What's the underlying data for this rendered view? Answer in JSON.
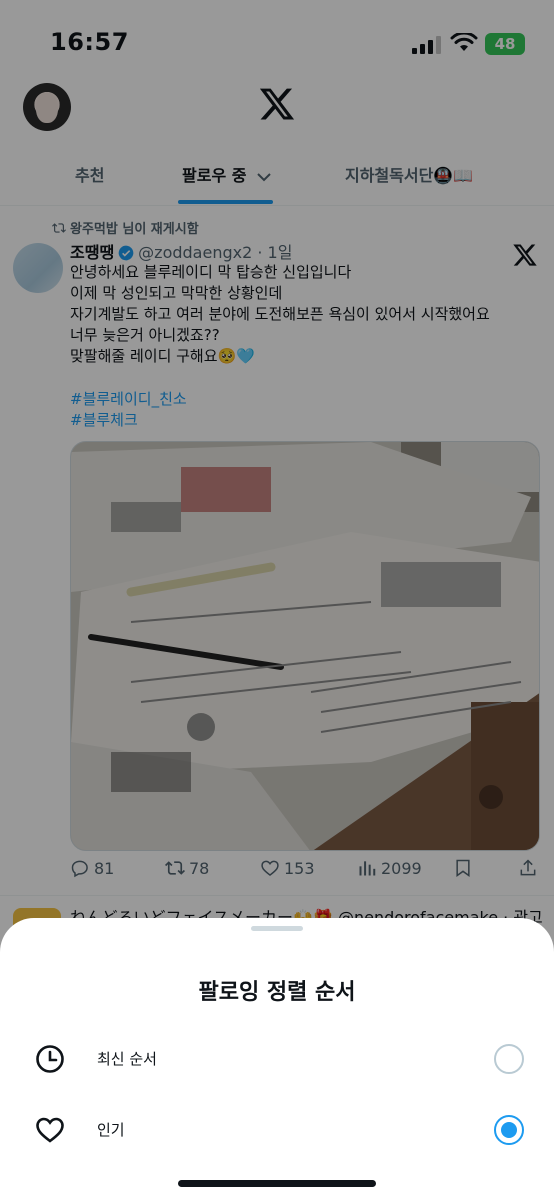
{
  "status_bar": {
    "time": "16:57",
    "battery": "48"
  },
  "tabs": [
    {
      "label": "추천"
    },
    {
      "label": "팔로우 중"
    },
    {
      "label": "지하철독서단🚇📖"
    }
  ],
  "tweet": {
    "reposted_by": "왕주먹밥 님이 재게시함",
    "author_name": "조땡땡",
    "handle": "@zoddaengx2",
    "age": "· 1일",
    "body": "안녕하세요 블루레이디 막 탑승한 신입입니다\n이제 막 성인되고 막막한 상황인데\n자기계발도 하고 여러 분야에 도전해보픈 욕심이 있어서 시작했어요\n너무 늦은거 아니겠죠??\n맞팔해줄 레이디 구해요🥺🩵",
    "hashtags": [
      "#블루레이디_친소",
      "#블루체크"
    ],
    "stats": {
      "replies": "81",
      "reposts": "78",
      "likes": "153",
      "views": "2099"
    }
  },
  "next_tweet": {
    "preview": "ねんどろいどフェイスメーカー🙌🎁 @nendorofacemake · 광고"
  },
  "sheet": {
    "title": "팔로잉 정렬 순서",
    "options": [
      {
        "label": "최신 순서",
        "icon": "clock-icon",
        "selected": false
      },
      {
        "label": "인기",
        "icon": "heart-icon",
        "selected": true
      }
    ]
  },
  "colors": {
    "accent": "#1d9bf0",
    "battery": "#34c759"
  }
}
